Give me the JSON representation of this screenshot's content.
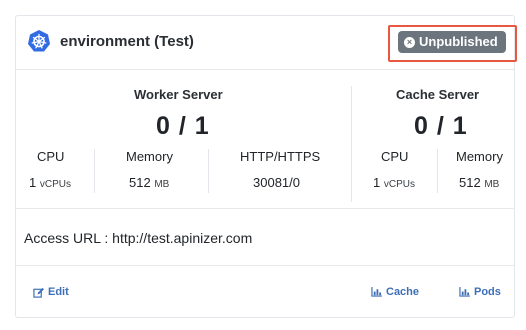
{
  "header": {
    "title": "environment (Test)",
    "status_badge": "Unpublished",
    "icon": "kubernetes-icon"
  },
  "worker_server": {
    "title": "Worker Server",
    "ratio": "0 / 1",
    "metrics": [
      {
        "label": "CPU",
        "value": "1",
        "unit": "vCPUs"
      },
      {
        "label": "Memory",
        "value": "512",
        "unit": "MB"
      },
      {
        "label": "HTTP/HTTPS",
        "value": "30081/0"
      }
    ]
  },
  "cache_server": {
    "title": "Cache Server",
    "ratio": "0 / 1",
    "metrics": [
      {
        "label": "CPU",
        "value": "1",
        "unit": "vCPUs"
      },
      {
        "label": "Memory",
        "value": "512",
        "unit": "MB"
      }
    ]
  },
  "access_url": "Access URL : http://test.apinizer.com",
  "footer": {
    "edit_label": "Edit",
    "cache_label": "Cache",
    "pods_label": "Pods"
  },
  "colors": {
    "badge_bg": "#6c757d",
    "highlight_border": "#e8573f",
    "link": "#3d6fb6",
    "kubernetes_blue": "#326ce5"
  }
}
